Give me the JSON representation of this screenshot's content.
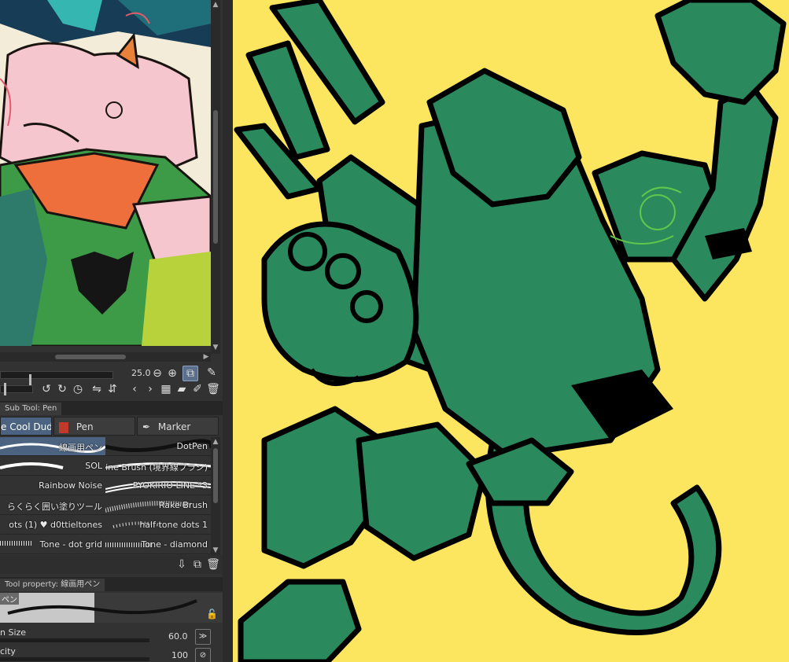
{
  "navigator": {
    "zoom_value": "25.0"
  },
  "subtool_panel": {
    "title": "Sub Tool: Pen",
    "groups": [
      {
        "label": "e Cool Dudes",
        "active": true
      },
      {
        "label": "Pen",
        "active": false
      },
      {
        "label": "Marker",
        "active": false
      }
    ],
    "brushes": [
      {
        "label": "線画用ペン",
        "col": 0,
        "selected": true
      },
      {
        "label": "DotPen",
        "col": 1
      },
      {
        "label": "SOL",
        "col": 0
      },
      {
        "label": "Outline Brush (境界線ブラシ)",
        "col": 1
      },
      {
        "label": "Rainbow Noise",
        "col": 0
      },
      {
        "label": "PYOKIRIO LINE *3",
        "col": 1
      },
      {
        "label": "らくらく囲い塗りツール",
        "col": 0
      },
      {
        "label": "Rake Brush",
        "col": 1
      },
      {
        "label": "ots (1) ♥ d0ttieltones",
        "col": 0
      },
      {
        "label": "half tone dots 1",
        "col": 1
      },
      {
        "label": "Tone - dot grid",
        "col": 0
      },
      {
        "label": "Tone - diamond",
        "col": 1
      }
    ]
  },
  "tool_property": {
    "title": "Tool property: 線画用ペン",
    "preview_label": "ペン",
    "brush_size_label": "n Size",
    "brush_size_value": "60.0",
    "opacity_label": "city",
    "opacity_value": "100"
  },
  "colors": {
    "canvas_bg": "#fde65f",
    "character_fill": "#2a8a5e",
    "outline": "#000000",
    "accent": "#4b6380"
  }
}
